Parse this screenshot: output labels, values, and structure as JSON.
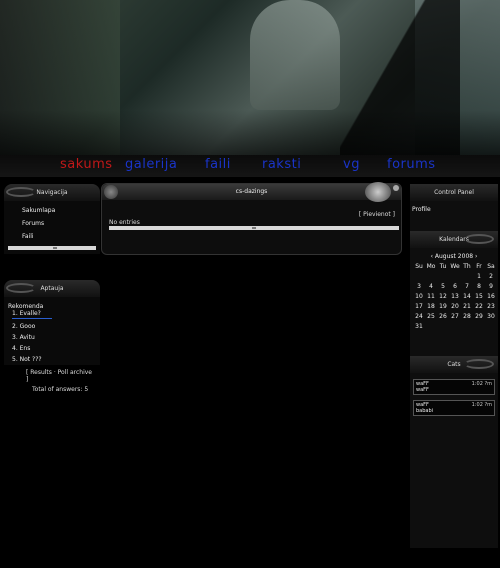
{
  "nav": {
    "items": [
      "sakums",
      "galerija",
      "faili",
      "raksti",
      "vg",
      "forums"
    ],
    "colors": {
      "active": "#c01818",
      "normal": "#1a34c8"
    }
  },
  "navigation_block": {
    "title": "Navigacija",
    "links": [
      "Sakumlapa",
      "Forums",
      "Faili"
    ]
  },
  "poll_block": {
    "title": "Aptauja",
    "question": "Rekomenda",
    "options": [
      "1. Evalle?",
      "2. Gooo",
      "3. Avitu",
      "4. Ens",
      "5. Not ???"
    ],
    "links": "[ Results · Poll archive ]",
    "total": "Total of answers: 5"
  },
  "center_block": {
    "title": "cs-dazings",
    "right_link": "[ Pievienot ]",
    "entries": "No entries"
  },
  "control_panel": {
    "title": "Control Panel",
    "profile": "Profile"
  },
  "calendar": {
    "title": "Kalendars",
    "month_label": "‹ August 2008 ›",
    "weekdays": [
      "Su",
      "Mo",
      "Tu",
      "We",
      "Th",
      "Fr",
      "Sa"
    ],
    "days": [
      "",
      "",
      "",
      "",
      "",
      "1",
      "2",
      "3",
      "4",
      "5",
      "6",
      "7",
      "8",
      "9",
      "10",
      "11",
      "12",
      "13",
      "14",
      "15",
      "16",
      "17",
      "18",
      "19",
      "20",
      "21",
      "22",
      "23",
      "24",
      "25",
      "26",
      "27",
      "28",
      "29",
      "30",
      "31",
      "",
      "",
      "",
      "",
      "",
      ""
    ]
  },
  "chat": {
    "title": "Cats",
    "entries": [
      {
        "user": "waFF",
        "text": "waFF",
        "time": "1:02 ?m"
      },
      {
        "user": "waFF",
        "text": "bababi",
        "time": "1:02 ?m"
      }
    ]
  }
}
